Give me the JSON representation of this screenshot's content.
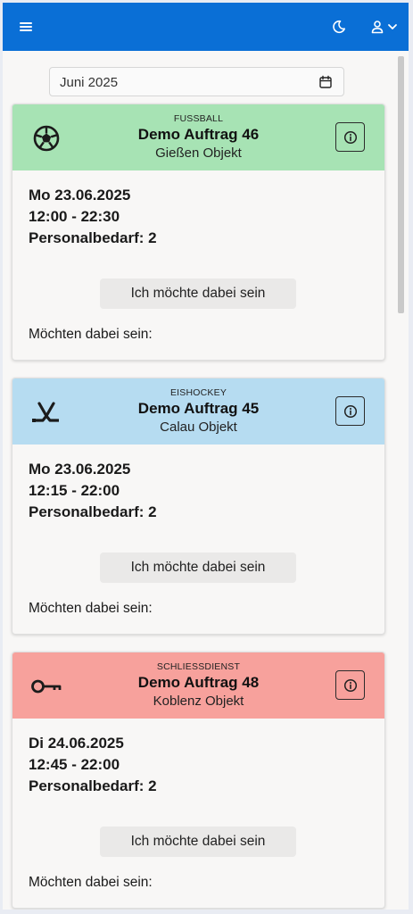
{
  "header": {
    "menu_icon": "hamburger-menu-icon",
    "theme_icon": "moon-icon",
    "user_icon": "user-icon",
    "user_dropdown_icon": "chevron-down-icon",
    "background_color": "#0a6fd6"
  },
  "month_picker": {
    "value": "Juni 2025",
    "icon": "calendar-icon"
  },
  "cards": [
    {
      "category": "FUSSBALL",
      "title": "Demo Auftrag 46",
      "location": "Gießen Objekt",
      "icon": "soccer-ball-icon",
      "header_color": "#a7e3b4",
      "date": "Mo 23.06.2025",
      "time": "12:00 - 22:30",
      "staff_need": "Personalbedarf: 2",
      "join_label": "Ich möchte dabei sein",
      "interested_label": "Möchten dabei sein:"
    },
    {
      "category": "EISHOCKEY",
      "title": "Demo Auftrag 45",
      "location": "Calau Objekt",
      "icon": "ice-hockey-icon",
      "header_color": "#b6dcf1",
      "date": "Mo 23.06.2025",
      "time": "12:15 - 22:00",
      "staff_need": "Personalbedarf: 2",
      "join_label": "Ich möchte dabei sein",
      "interested_label": "Möchten dabei sein:"
    },
    {
      "category": "SCHLIESSDIENST",
      "title": "Demo Auftrag 48",
      "location": "Koblenz Objekt",
      "icon": "key-icon",
      "header_color": "#f7a19c",
      "date": "Di 24.06.2025",
      "time": "12:45 - 22:00",
      "staff_need": "Personalbedarf: 2",
      "join_label": "Ich möchte dabei sein",
      "interested_label": "Möchten dabei sein:"
    }
  ]
}
